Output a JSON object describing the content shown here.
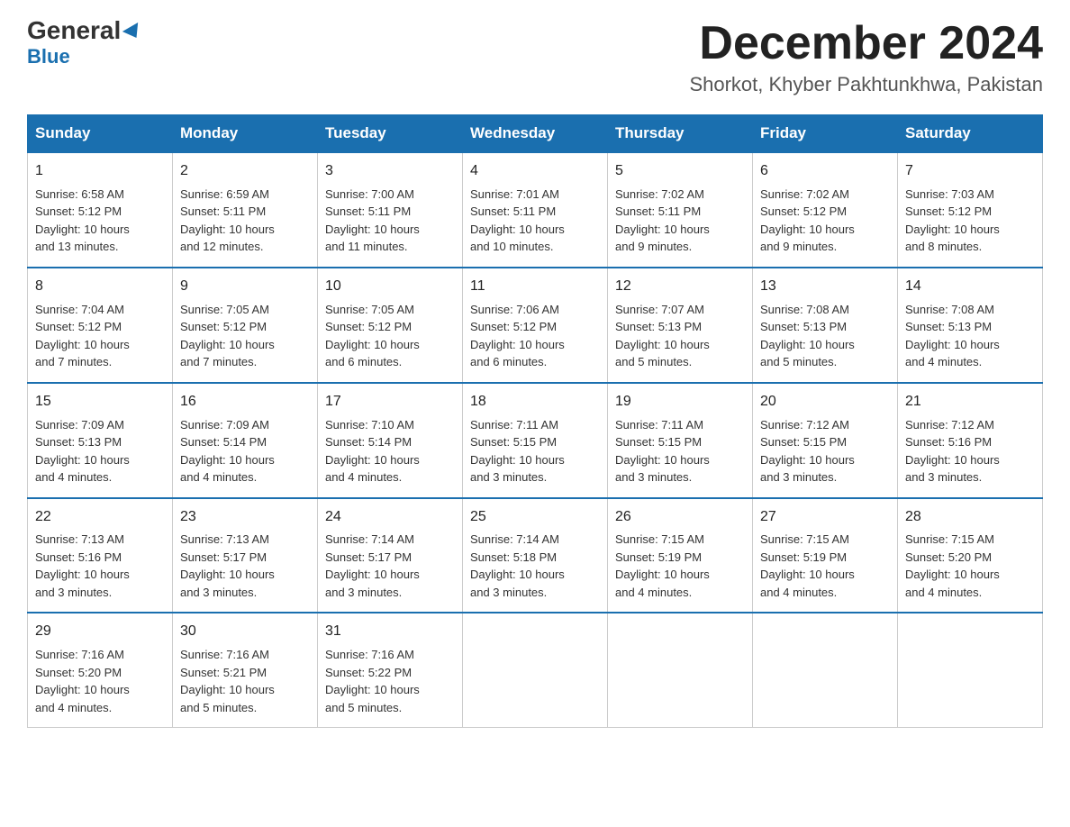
{
  "header": {
    "logo_general": "General",
    "logo_blue": "Blue",
    "month_title": "December 2024",
    "location": "Shorkot, Khyber Pakhtunkhwa, Pakistan"
  },
  "days_of_week": [
    "Sunday",
    "Monday",
    "Tuesday",
    "Wednesday",
    "Thursday",
    "Friday",
    "Saturday"
  ],
  "weeks": [
    [
      {
        "day": "1",
        "sunrise": "6:58 AM",
        "sunset": "5:12 PM",
        "daylight": "10 hours and 13 minutes."
      },
      {
        "day": "2",
        "sunrise": "6:59 AM",
        "sunset": "5:11 PM",
        "daylight": "10 hours and 12 minutes."
      },
      {
        "day": "3",
        "sunrise": "7:00 AM",
        "sunset": "5:11 PM",
        "daylight": "10 hours and 11 minutes."
      },
      {
        "day": "4",
        "sunrise": "7:01 AM",
        "sunset": "5:11 PM",
        "daylight": "10 hours and 10 minutes."
      },
      {
        "day": "5",
        "sunrise": "7:02 AM",
        "sunset": "5:11 PM",
        "daylight": "10 hours and 9 minutes."
      },
      {
        "day": "6",
        "sunrise": "7:02 AM",
        "sunset": "5:12 PM",
        "daylight": "10 hours and 9 minutes."
      },
      {
        "day": "7",
        "sunrise": "7:03 AM",
        "sunset": "5:12 PM",
        "daylight": "10 hours and 8 minutes."
      }
    ],
    [
      {
        "day": "8",
        "sunrise": "7:04 AM",
        "sunset": "5:12 PM",
        "daylight": "10 hours and 7 minutes."
      },
      {
        "day": "9",
        "sunrise": "7:05 AM",
        "sunset": "5:12 PM",
        "daylight": "10 hours and 7 minutes."
      },
      {
        "day": "10",
        "sunrise": "7:05 AM",
        "sunset": "5:12 PM",
        "daylight": "10 hours and 6 minutes."
      },
      {
        "day": "11",
        "sunrise": "7:06 AM",
        "sunset": "5:12 PM",
        "daylight": "10 hours and 6 minutes."
      },
      {
        "day": "12",
        "sunrise": "7:07 AM",
        "sunset": "5:13 PM",
        "daylight": "10 hours and 5 minutes."
      },
      {
        "day": "13",
        "sunrise": "7:08 AM",
        "sunset": "5:13 PM",
        "daylight": "10 hours and 5 minutes."
      },
      {
        "day": "14",
        "sunrise": "7:08 AM",
        "sunset": "5:13 PM",
        "daylight": "10 hours and 4 minutes."
      }
    ],
    [
      {
        "day": "15",
        "sunrise": "7:09 AM",
        "sunset": "5:13 PM",
        "daylight": "10 hours and 4 minutes."
      },
      {
        "day": "16",
        "sunrise": "7:09 AM",
        "sunset": "5:14 PM",
        "daylight": "10 hours and 4 minutes."
      },
      {
        "day": "17",
        "sunrise": "7:10 AM",
        "sunset": "5:14 PM",
        "daylight": "10 hours and 4 minutes."
      },
      {
        "day": "18",
        "sunrise": "7:11 AM",
        "sunset": "5:15 PM",
        "daylight": "10 hours and 3 minutes."
      },
      {
        "day": "19",
        "sunrise": "7:11 AM",
        "sunset": "5:15 PM",
        "daylight": "10 hours and 3 minutes."
      },
      {
        "day": "20",
        "sunrise": "7:12 AM",
        "sunset": "5:15 PM",
        "daylight": "10 hours and 3 minutes."
      },
      {
        "day": "21",
        "sunrise": "7:12 AM",
        "sunset": "5:16 PM",
        "daylight": "10 hours and 3 minutes."
      }
    ],
    [
      {
        "day": "22",
        "sunrise": "7:13 AM",
        "sunset": "5:16 PM",
        "daylight": "10 hours and 3 minutes."
      },
      {
        "day": "23",
        "sunrise": "7:13 AM",
        "sunset": "5:17 PM",
        "daylight": "10 hours and 3 minutes."
      },
      {
        "day": "24",
        "sunrise": "7:14 AM",
        "sunset": "5:17 PM",
        "daylight": "10 hours and 3 minutes."
      },
      {
        "day": "25",
        "sunrise": "7:14 AM",
        "sunset": "5:18 PM",
        "daylight": "10 hours and 3 minutes."
      },
      {
        "day": "26",
        "sunrise": "7:15 AM",
        "sunset": "5:19 PM",
        "daylight": "10 hours and 4 minutes."
      },
      {
        "day": "27",
        "sunrise": "7:15 AM",
        "sunset": "5:19 PM",
        "daylight": "10 hours and 4 minutes."
      },
      {
        "day": "28",
        "sunrise": "7:15 AM",
        "sunset": "5:20 PM",
        "daylight": "10 hours and 4 minutes."
      }
    ],
    [
      {
        "day": "29",
        "sunrise": "7:16 AM",
        "sunset": "5:20 PM",
        "daylight": "10 hours and 4 minutes."
      },
      {
        "day": "30",
        "sunrise": "7:16 AM",
        "sunset": "5:21 PM",
        "daylight": "10 hours and 5 minutes."
      },
      {
        "day": "31",
        "sunrise": "7:16 AM",
        "sunset": "5:22 PM",
        "daylight": "10 hours and 5 minutes."
      },
      null,
      null,
      null,
      null
    ]
  ],
  "labels": {
    "sunrise": "Sunrise:",
    "sunset": "Sunset:",
    "daylight": "Daylight:"
  }
}
